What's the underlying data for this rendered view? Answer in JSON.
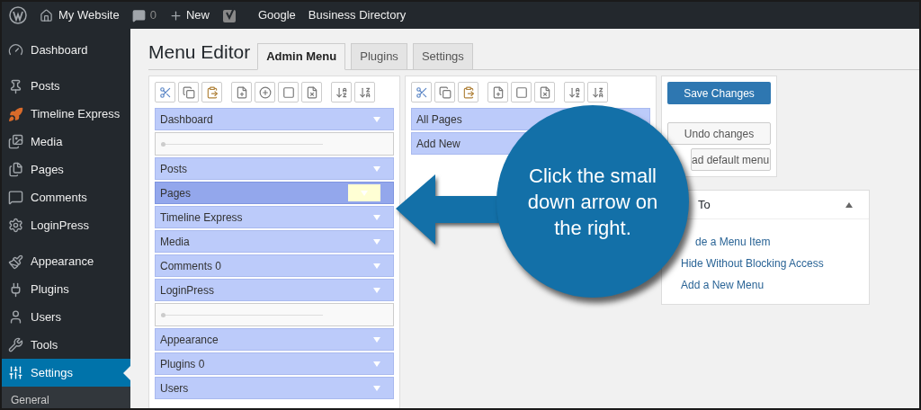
{
  "admin_bar": {
    "site": "My Website",
    "comments": "0",
    "new": "New",
    "links": [
      "Google",
      "Business Directory"
    ]
  },
  "sidebar": {
    "items": [
      {
        "label": "Dashboard",
        "selected": false,
        "gap_after": true
      },
      {
        "label": "Posts",
        "selected": false,
        "gap_after": false
      },
      {
        "label": "Timeline Express",
        "selected": false,
        "gap_after": false
      },
      {
        "label": "Media",
        "selected": false,
        "gap_after": false
      },
      {
        "label": "Pages",
        "selected": false,
        "gap_after": false
      },
      {
        "label": "Comments",
        "selected": false,
        "gap_after": false
      },
      {
        "label": "LoginPress",
        "selected": false,
        "gap_after": true
      },
      {
        "label": "Appearance",
        "selected": false,
        "gap_after": false
      },
      {
        "label": "Plugins",
        "selected": false,
        "gap_after": false
      },
      {
        "label": "Users",
        "selected": false,
        "gap_after": false
      },
      {
        "label": "Tools",
        "selected": false,
        "gap_after": false
      },
      {
        "label": "Settings",
        "selected": true,
        "gap_after": false
      }
    ],
    "submenu": [
      "General"
    ]
  },
  "page_title": "Menu Editor",
  "tabs": [
    {
      "label": "Admin Menu",
      "selected": true
    },
    {
      "label": "Plugins",
      "selected": false
    },
    {
      "label": "Settings",
      "selected": false
    }
  ],
  "top_menu": [
    {
      "kind": "item",
      "label": "Dashboard",
      "selected": false
    },
    {
      "kind": "separator"
    },
    {
      "kind": "item",
      "label": "Posts",
      "selected": false
    },
    {
      "kind": "item",
      "label": "Pages",
      "selected": true
    },
    {
      "kind": "item",
      "label": "Timeline Express",
      "selected": false
    },
    {
      "kind": "item",
      "label": "Media",
      "selected": false
    },
    {
      "kind": "item",
      "label": "Comments 0",
      "selected": false
    },
    {
      "kind": "item",
      "label": "LoginPress",
      "selected": false
    },
    {
      "kind": "separator"
    },
    {
      "kind": "item",
      "label": "Appearance",
      "selected": false
    },
    {
      "kind": "item",
      "label": "Plugins 0",
      "selected": false
    },
    {
      "kind": "item",
      "label": "Users",
      "selected": false
    }
  ],
  "submenu_items": [
    {
      "label": "All Pages"
    },
    {
      "label": "Add New"
    }
  ],
  "buttons": {
    "save": "Save Changes",
    "undo": "Undo changes",
    "load_default": "ad default menu"
  },
  "how_to": {
    "title": "To",
    "links": [
      "de a Menu Item",
      "Hide Without Blocking Access",
      "Add a New Menu"
    ]
  },
  "callout": "Click the small down arrow on the right."
}
